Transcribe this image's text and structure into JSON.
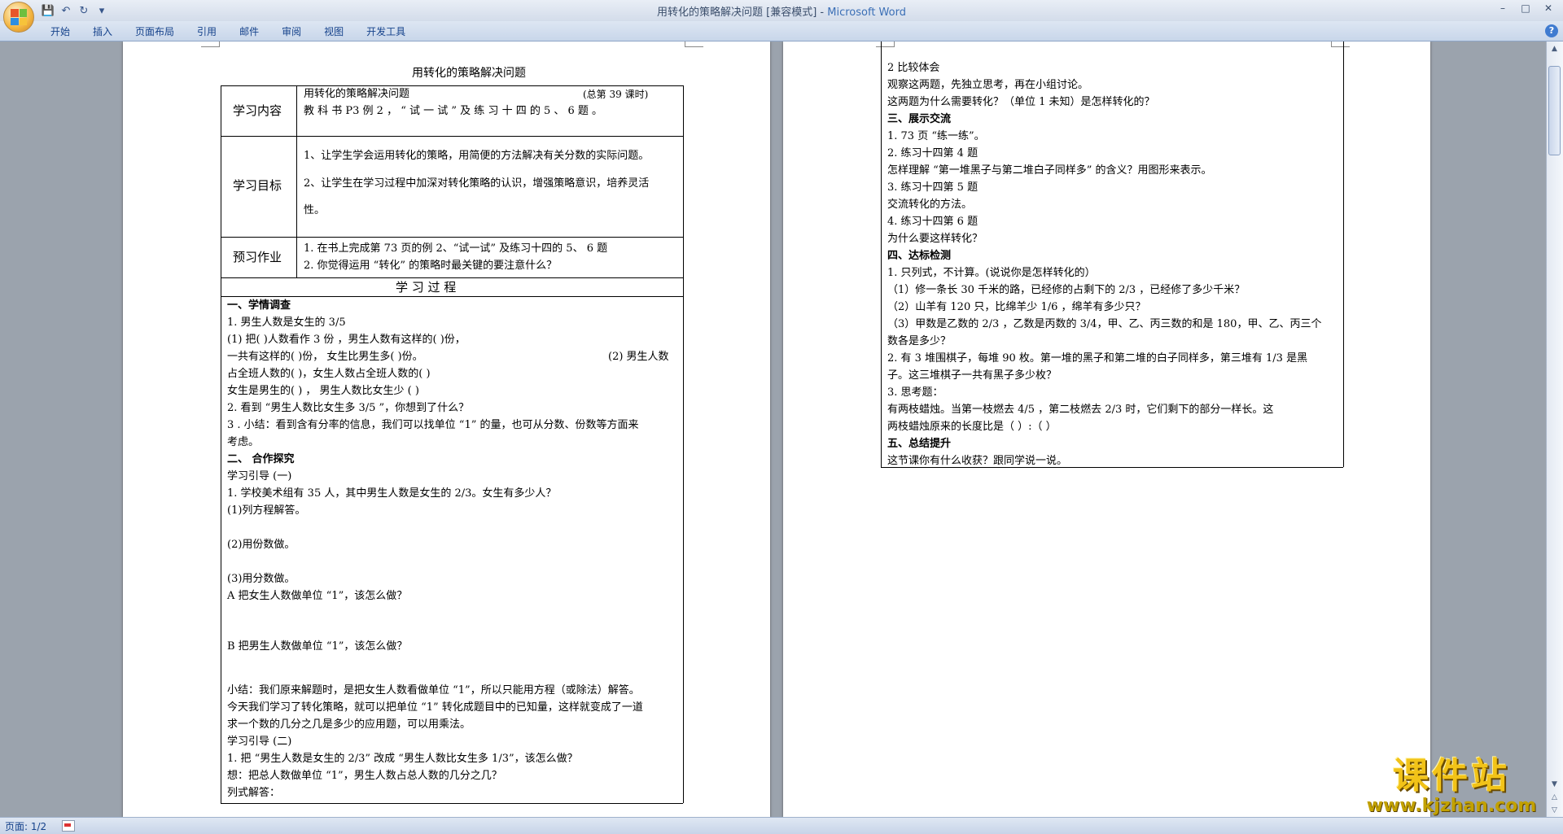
{
  "window": {
    "title": "用转化的策略解决问题 [兼容模式] - ",
    "brand": "Microsoft Word"
  },
  "quick_access": [
    "save-icon",
    "undo-icon",
    "redo-icon",
    "customize-icon"
  ],
  "ribbon": {
    "tabs": [
      "开始",
      "插入",
      "页面布局",
      "引用",
      "邮件",
      "审阅",
      "视图",
      "开发工具"
    ]
  },
  "status": {
    "page": "页面: 1/2"
  },
  "watermark": {
    "text": "课件站",
    "url": "www.kjzhan.com"
  },
  "page1": {
    "title": "用转化的策略解决问题",
    "rows": {
      "content_label": "学习内容",
      "content_line1": "用转化的策略解决问题",
      "content_lesson": "(总第 39 课时)",
      "content_line2": "教 科 书  P3  例  2 ，  “ 试 一 试 ” 及 练 习 十 四 的   5 、   6   题   。",
      "goal_label": "学习目标",
      "goal_1": "1、让学生学会运用转化的策略，用简便的方法解决有关分数的实际问题。",
      "goal_2a": "2、让学生在学习过程中加深对转化策略的认识，增强策略意识，培养灵活",
      "goal_2b": "性。",
      "prep_label": "预习作业",
      "prep_1": "1. 在书上完成第 73 页的例 2、“试一试” 及练习十四的 5、 6 题",
      "prep_2": "2. 你觉得运用 “转化” 的策略时最关键的要注意什么？",
      "process": "学    习    过    程"
    },
    "body": [
      "一、学情调查",
      "1. 男生人数是女生的 3/5",
      "(1) 把(        )人数看作 3 份 ，男生人数有这样的(        )份，",
      "一共有这样的(    )份， 女生比男生多(  )份。",
      "(2) 男生人数",
      "占全班人数的(     )，女生人数占全班人数的(     )",
      "女生是男生的(      )  ，  男生人数比女生少 (   )",
      "2. 看到 “男生人数比女生多 3/5 ”，你想到了什么？",
      "3 . 小结：看到含有分率的信息，我们可以找单位 “1” 的量，也可从分数、份数等方面来",
      "考虑。",
      "二、 合作探究",
      "学习引导 (一)",
      "1. 学校美术组有 35 人，其中男生人数是女生的 2/3。女生有多少人？",
      "(1)列方程解答。",
      "(2)用份数做。",
      "(3)用分数做。",
      "A 把女生人数做单位 “1”，该怎么做？",
      "B 把男生人数做单位 “1”，该怎么做？",
      "小结：我们原来解题时，是把女生人数看做单位 “1”，所以只能用方程（或除法）解答。",
      "今天我们学习了转化策略，就可以把单位 “1” 转化成题目中的已知量，这样就变成了一道",
      "求一个数的几分之几是多少的应用题，可以用乘法。",
      "学习引导 (二)",
      "   1. 把 “男生人数是女生的 2/3” 改成 “男生人数比女生多 1/3”，该怎么做？",
      "想：把总人数做单位 “1”，男生人数占总人数的几分之几？",
      "列式解答："
    ]
  },
  "page2": {
    "lines": [
      "2 比较体会",
      "观察这两题，先独立思考，再在小组讨论。",
      "这两题为什么需要转化？（单位 1 未知）是怎样转化的？",
      "三、展示交流",
      "1. 73 页 “练一练”。",
      "2. 练习十四第 4 题",
      "怎样理解 “第一堆黑子与第二堆白子同样多” 的含义？用图形来表示。",
      "3. 练习十四第 5 题",
      "交流转化的方法。",
      "4. 练习十四第 6 题",
      "为什么要这样转化？",
      "四、达标检测",
      "1. 只列式，不计算。(说说你是怎样转化的）",
      "（1）修一条长 30 千米的路，已经修的占剩下的    2/3    ，已经修了多少千米？",
      "（2）山羊有 120 只，比绵羊少    1/6    ，绵羊有多少只？",
      "（3）甲数是乙数的 2/3 ，乙数是丙数的 3/4，甲、乙、丙三数的和是 180，甲、乙、丙三个",
      "数各是多少？",
      "2. 有 3 堆围棋子，每堆 90 枚。第一堆的黑子和第二堆的白子同样多，第三堆有  1/3 是黑",
      "子。这三堆棋子一共有黑子多少枚？",
      "3. 思考题：",
      "     有两枝蜡烛。当第一枝燃去 4/5    ，第二枝燃去  2/3    时，它们剩下的部分一样长。这",
      "两枝蜡烛原来的长度比是（       ）:（       ）",
      "五、总结提升",
      "     这节课你有什么收获？跟同学说一说。"
    ]
  }
}
